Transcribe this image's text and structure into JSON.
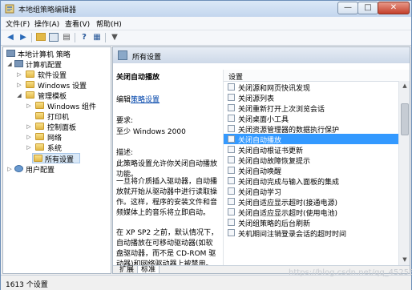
{
  "window": {
    "title": "本地组策略编辑器",
    "close_label": "✕",
    "min_label": "—",
    "max_label": "□"
  },
  "menubar": [
    "文件(F)",
    "操作(A)",
    "查看(V)",
    "帮助(H)"
  ],
  "tree": {
    "items": [
      {
        "label": "本地计算机 策略",
        "icon": "computer-policy-icon"
      },
      {
        "label": "计算机配置",
        "icon": "computer-icon"
      },
      {
        "label": "软件设置",
        "icon": "folder-icon"
      },
      {
        "label": "Windows 设置",
        "icon": "folder-icon"
      },
      {
        "label": "管理模板",
        "icon": "folder-icon"
      },
      {
        "label": "Windows 组件",
        "icon": "folder-icon"
      },
      {
        "label": "打印机",
        "icon": "folder-icon"
      },
      {
        "label": "控制面板",
        "icon": "folder-icon"
      },
      {
        "label": "网络",
        "icon": "folder-icon"
      },
      {
        "label": "系统",
        "icon": "folder-icon"
      },
      {
        "label": "所有设置",
        "icon": "folder-icon"
      },
      {
        "label": "用户配置",
        "icon": "user-icon"
      }
    ]
  },
  "details": {
    "header_title": "所有设置",
    "description": {
      "title": "关闭自动播放",
      "edit_prefix": "编辑",
      "edit_link": "策略设置",
      "requirements_label": "要求:",
      "requirements_value": "至少 Windows 2000",
      "description_label": "描述:",
      "description_text": "此策略设置允许你关闭自动播放功能。",
      "para1": "一旦将介质插入驱动器，自动播放就开始从驱动器中进行读取操作。这样，程序的安装文件和音频媒体上的音乐将立即启动。",
      "para2": "在 XP SP2 之前，默认情况下，自动播放在可移动驱动器(如软盘驱动器，而不是 CD-ROM 驱动器)和网络驱动器上被禁用。"
    },
    "list_header": "设置",
    "settings": [
      "关闭源和网页快讯发现",
      "关闭源列表",
      "关闭重新打开上次浏览会话",
      "关闭桌面小工具",
      "关闭资源管理器的数据执行保护",
      "关闭自动播放",
      "关闭自动根证书更新",
      "关闭自动故障恢复提示",
      "关闭自动唤醒",
      "关闭自动完成与输入面板的集成",
      "关闭自动学习",
      "关闭自适应显示超时(接通电源)",
      "关闭自适应显示超时(使用电池)",
      "关闭组策略的后台刷新",
      "关机期间注销登录会话的超时时间"
    ],
    "selected_index": 5,
    "tabs": [
      "扩展",
      "标准"
    ]
  },
  "statusbar": {
    "text": "1613 个设置"
  },
  "watermark": "https://blog.csdn.net/qq_45256362"
}
